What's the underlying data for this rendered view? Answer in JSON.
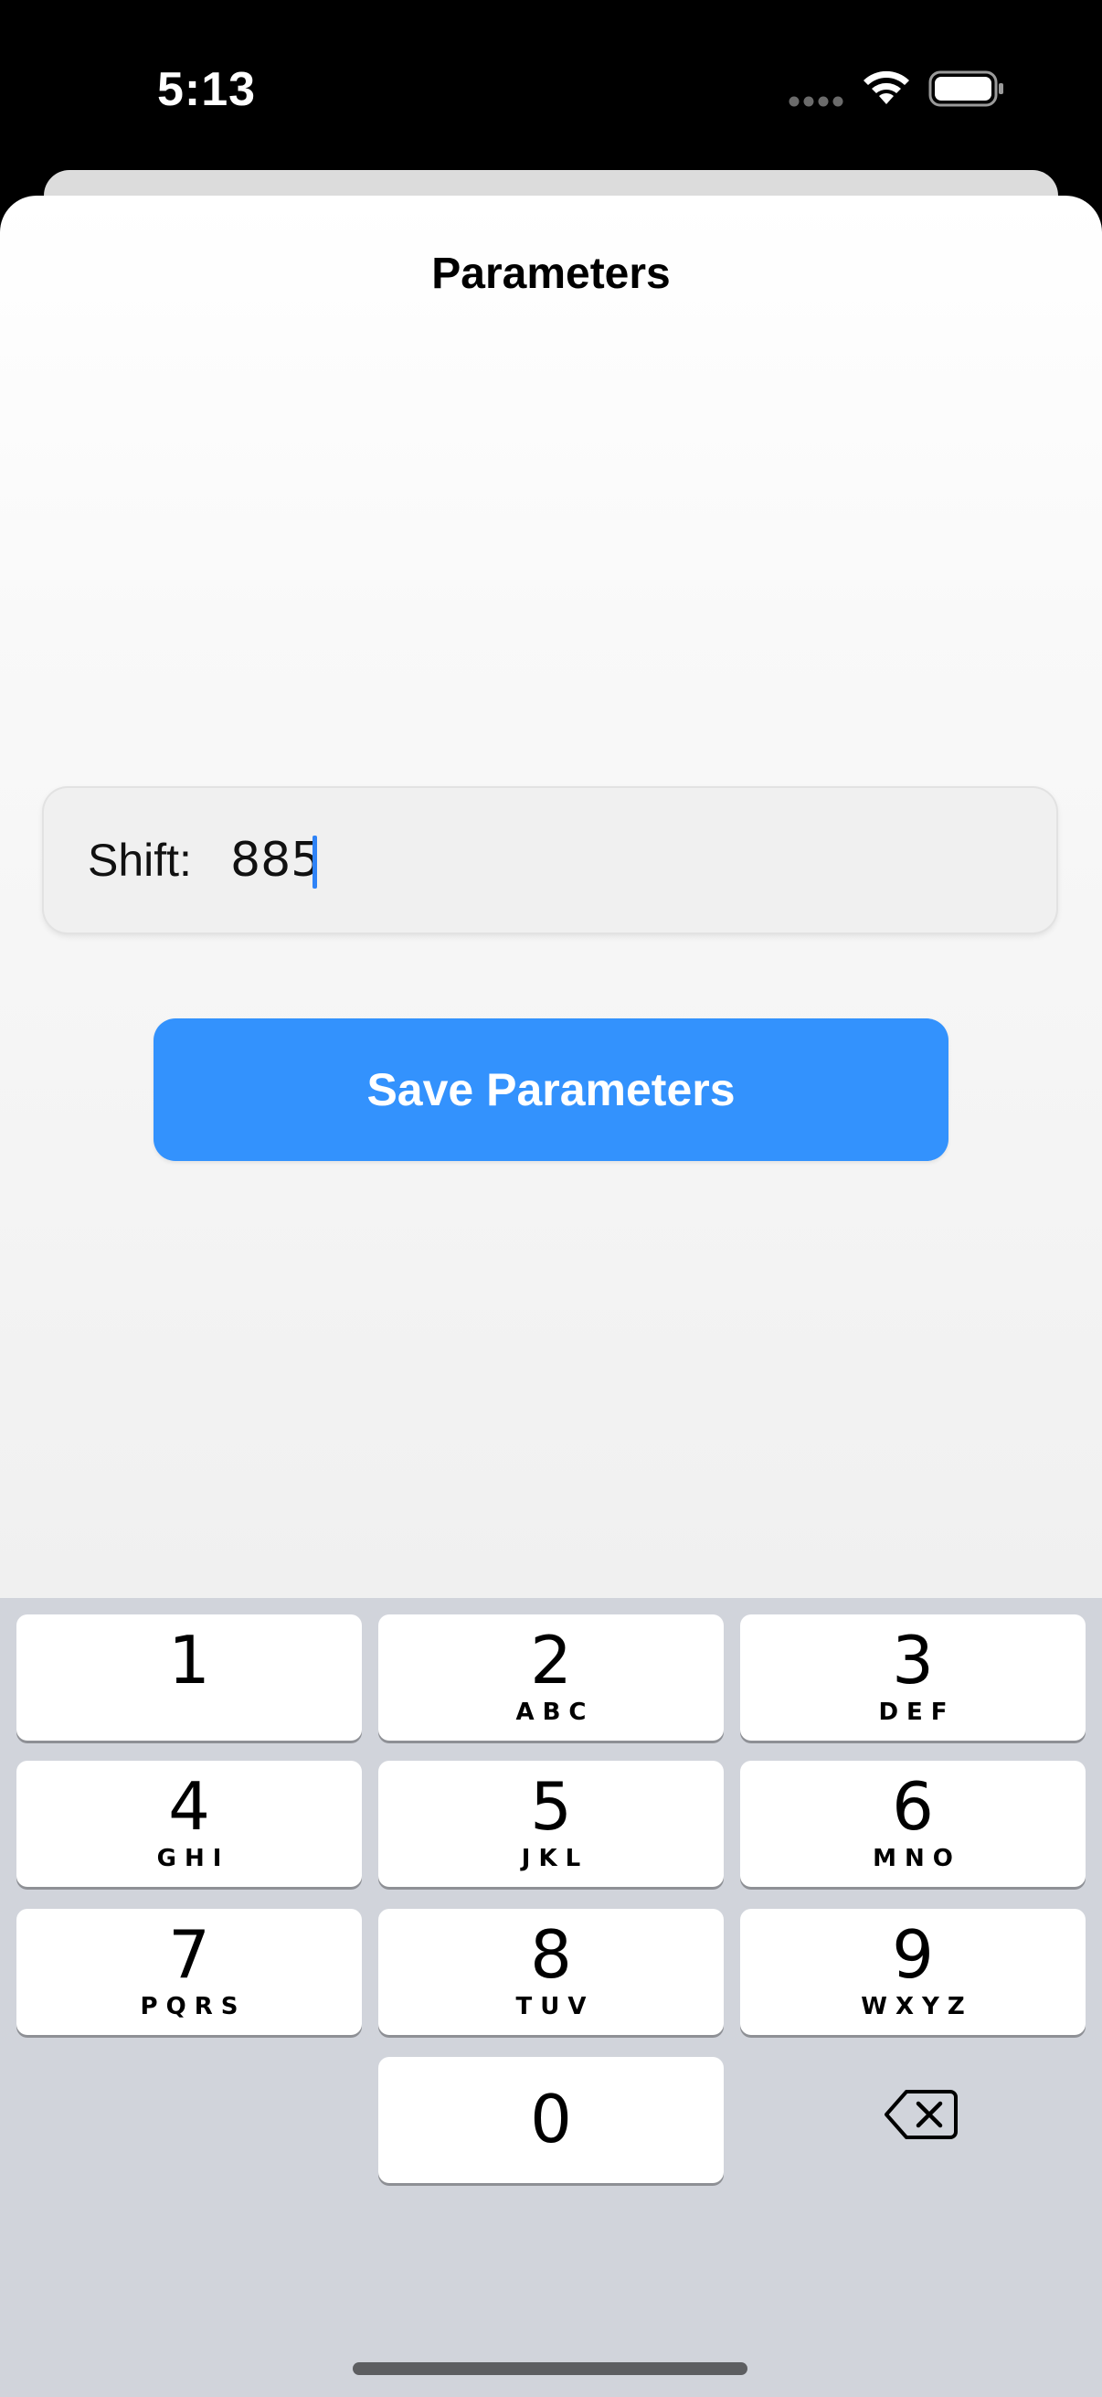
{
  "status_bar": {
    "time": "5:13",
    "icons": [
      "signal-dots-icon",
      "wifi-icon",
      "battery-icon"
    ]
  },
  "sheet": {
    "title": "Parameters",
    "field": {
      "label": "Shift:",
      "value": "885"
    },
    "save_button": "Save Parameters"
  },
  "keyboard": {
    "keys": [
      {
        "digit": "1",
        "letters": ""
      },
      {
        "digit": "2",
        "letters": "ABC"
      },
      {
        "digit": "3",
        "letters": "DEF"
      },
      {
        "digit": "4",
        "letters": "GHI"
      },
      {
        "digit": "5",
        "letters": "JKL"
      },
      {
        "digit": "6",
        "letters": "MNO"
      },
      {
        "digit": "7",
        "letters": "PQRS"
      },
      {
        "digit": "8",
        "letters": "TUV"
      },
      {
        "digit": "9",
        "letters": "WXYZ"
      },
      {
        "digit": "0",
        "letters": ""
      }
    ],
    "delete_icon": "backspace-icon"
  },
  "colors": {
    "accent": "#3392fd",
    "caret": "#2f83f7",
    "keyboard_bg": "#d1d4db"
  }
}
